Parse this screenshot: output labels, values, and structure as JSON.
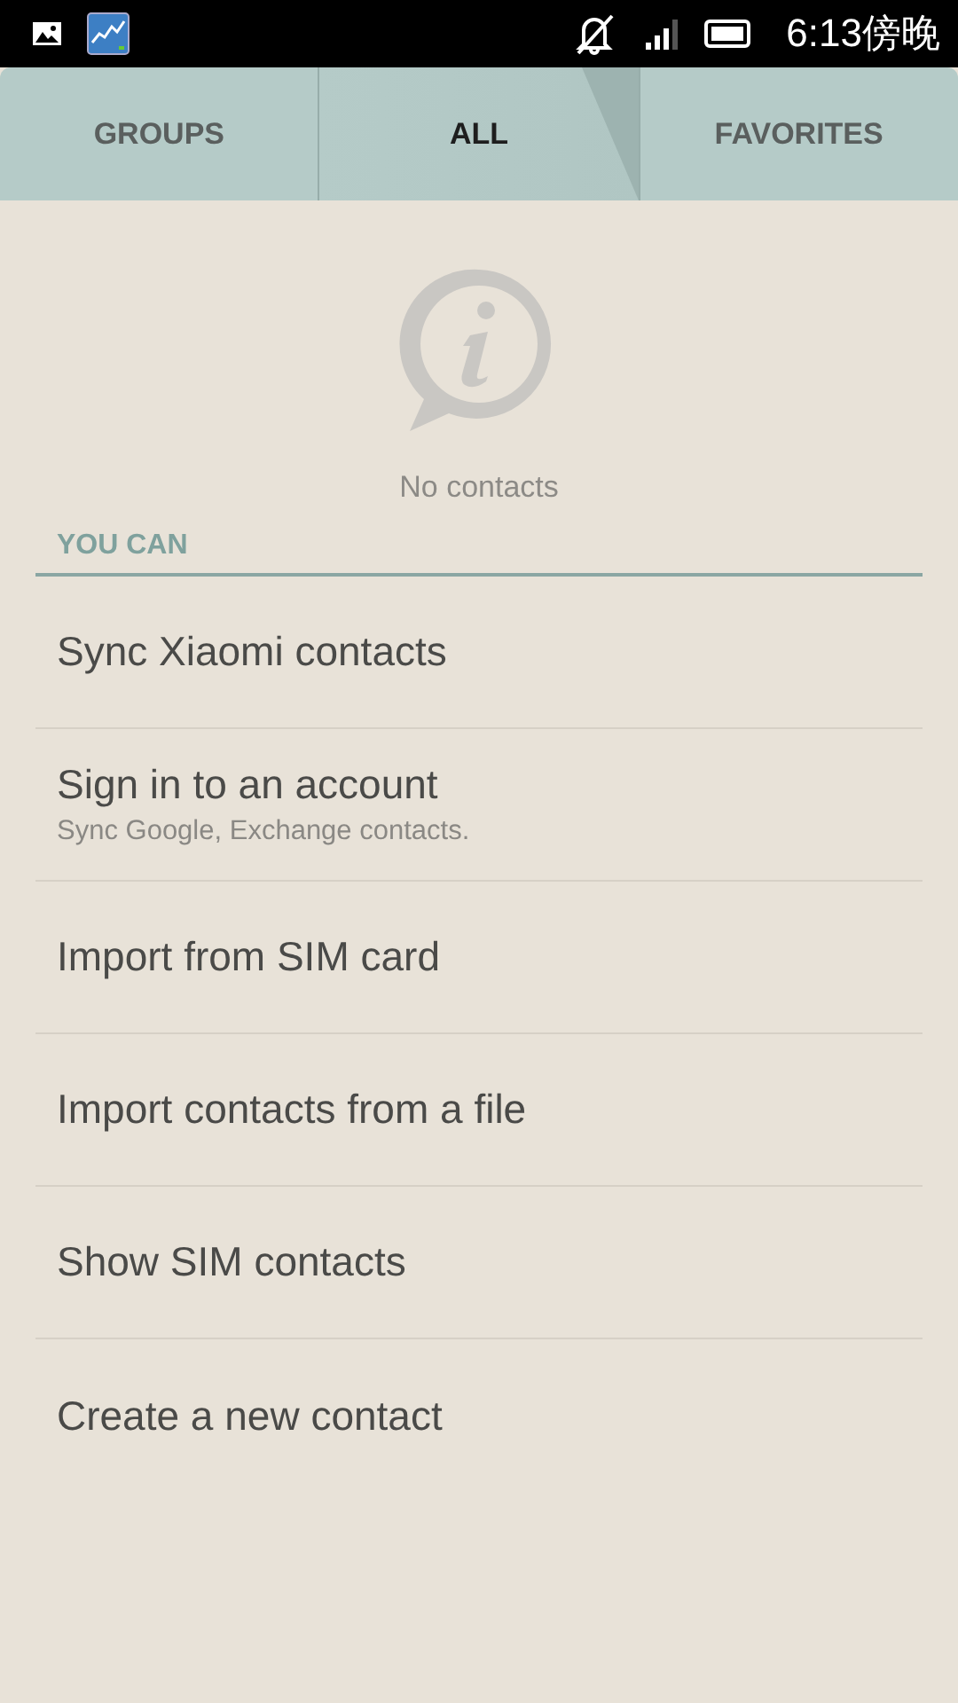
{
  "status_bar": {
    "time": "6:13傍晚"
  },
  "tabs": [
    {
      "label": "GROUPS",
      "selected": false
    },
    {
      "label": "ALL",
      "selected": true
    },
    {
      "label": "FAVORITES",
      "selected": false
    }
  ],
  "empty_state": {
    "message": "No contacts"
  },
  "section": {
    "title": "YOU CAN"
  },
  "options": [
    {
      "title": "Sync Xiaomi contacts"
    },
    {
      "title": "Sign in to an account",
      "subtitle": "Sync Google, Exchange contacts."
    },
    {
      "title": "Import from SIM card"
    },
    {
      "title": "Import contacts from a file"
    },
    {
      "title": "Show SIM contacts"
    },
    {
      "title": "Create a new contact"
    }
  ]
}
